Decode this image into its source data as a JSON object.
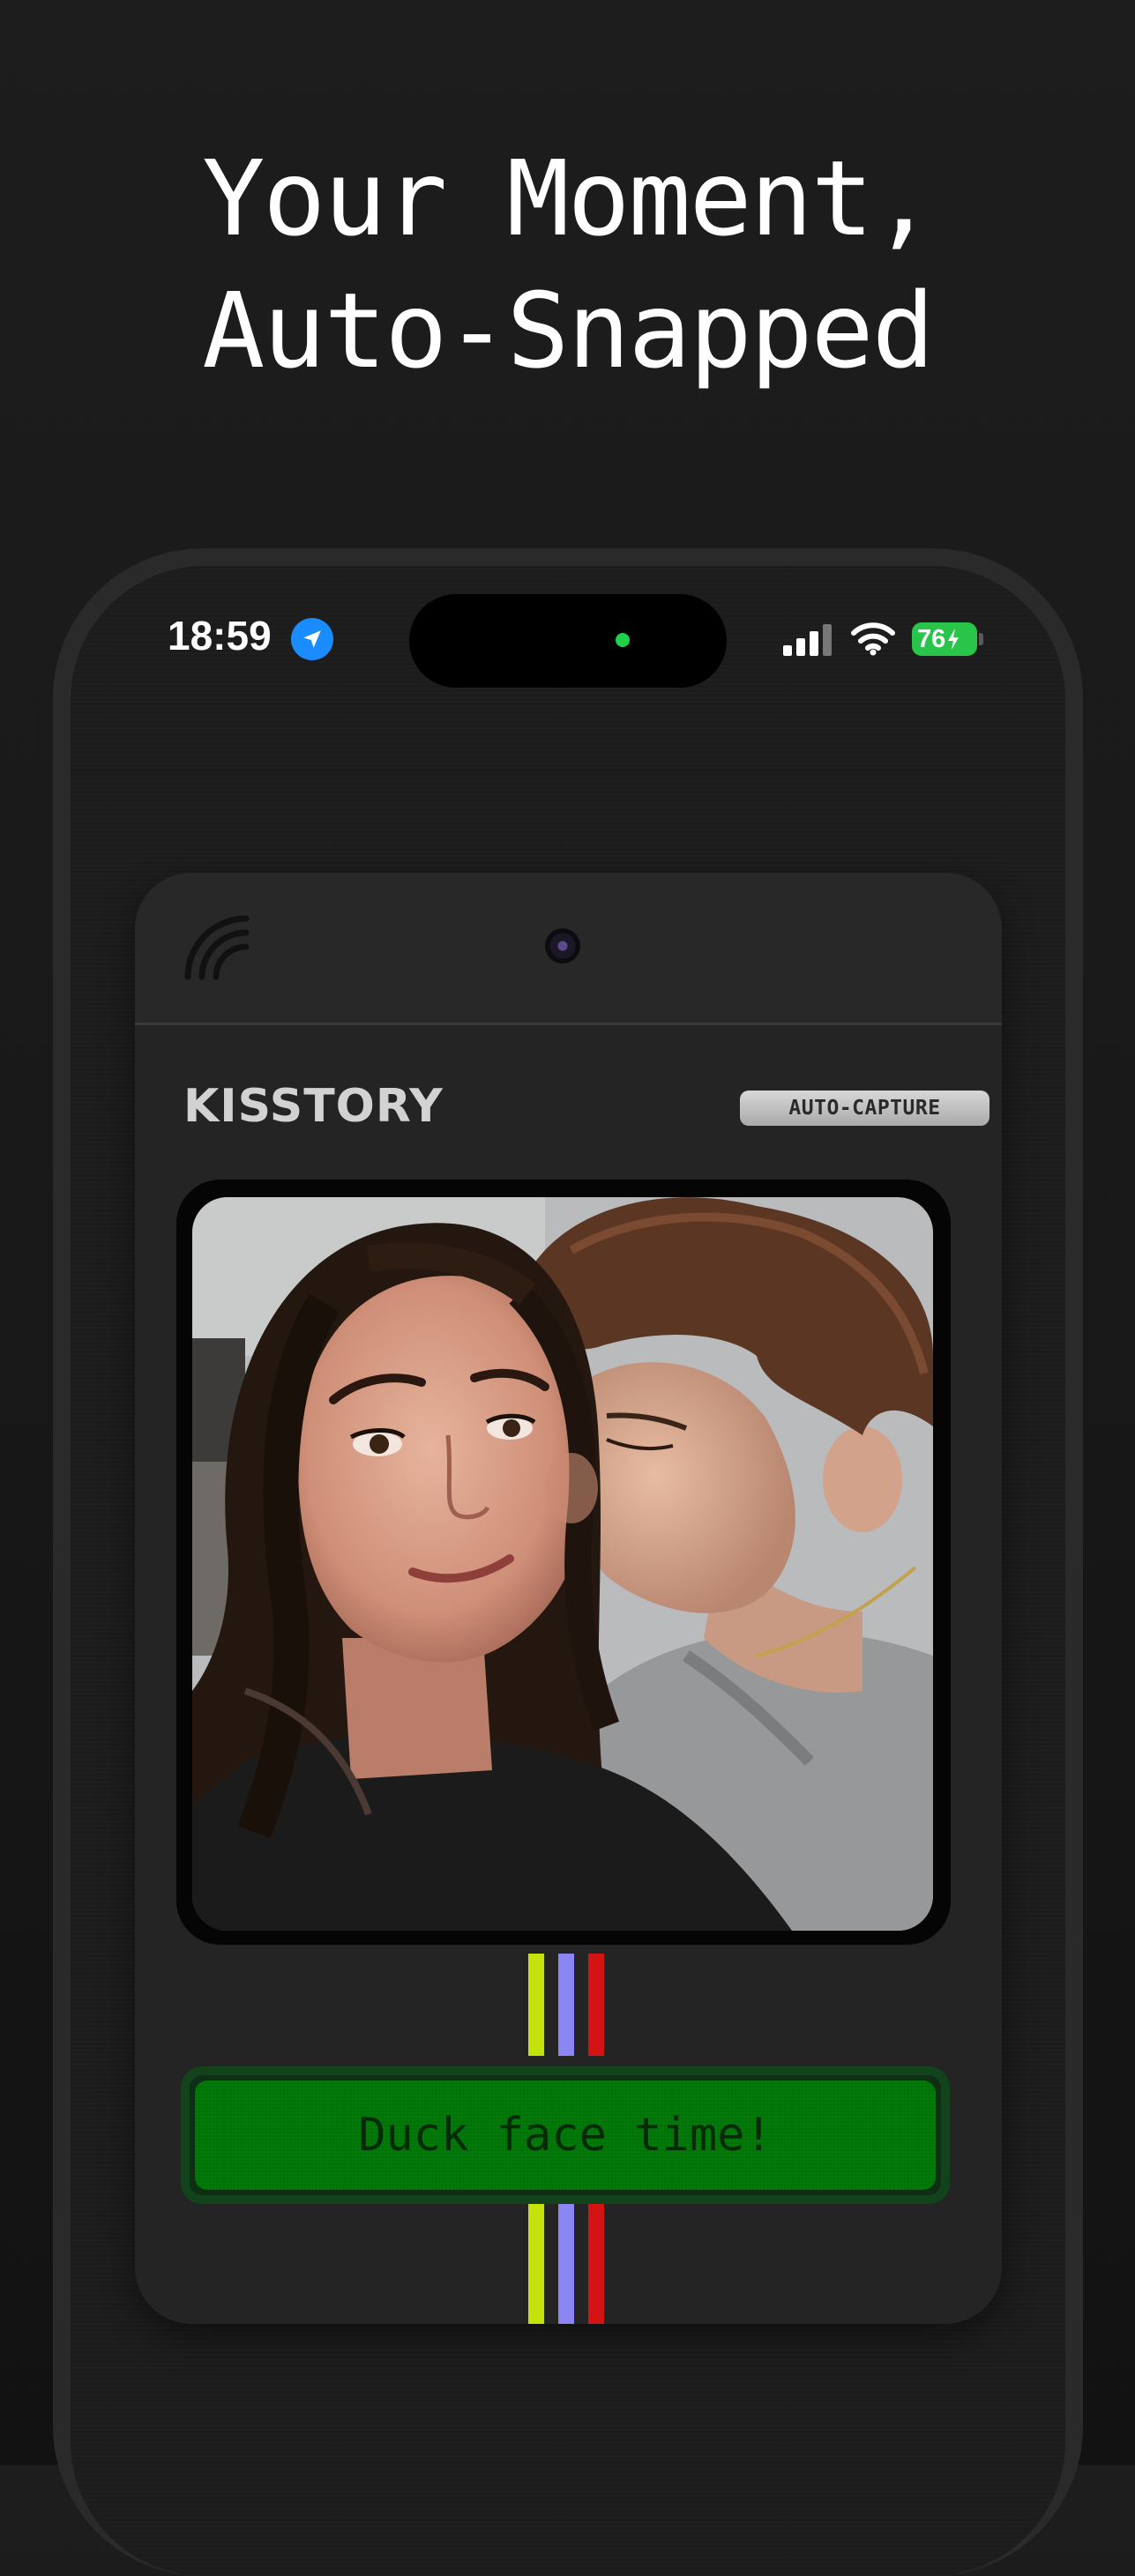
{
  "headline": {
    "line1": "Your Moment,",
    "line2": "Auto-Snapped"
  },
  "status_bar": {
    "time": "18:59",
    "battery": "76",
    "location_icon": "location-arrow-icon",
    "signal_icon": "cellular-signal-icon",
    "wifi_icon": "wifi-icon",
    "battery_icon": "battery-charging-icon"
  },
  "app": {
    "brand": "KISSTORY",
    "badge": "AUTO-CAPTURE",
    "lcd_message": "Duck face time!",
    "photo_alt": "Couple selfie, man kissing woman on cheek",
    "stripe_colors": [
      "#c5e20c",
      "#8c86f2",
      "#d41414"
    ],
    "lcd_color": "#037d0a"
  }
}
